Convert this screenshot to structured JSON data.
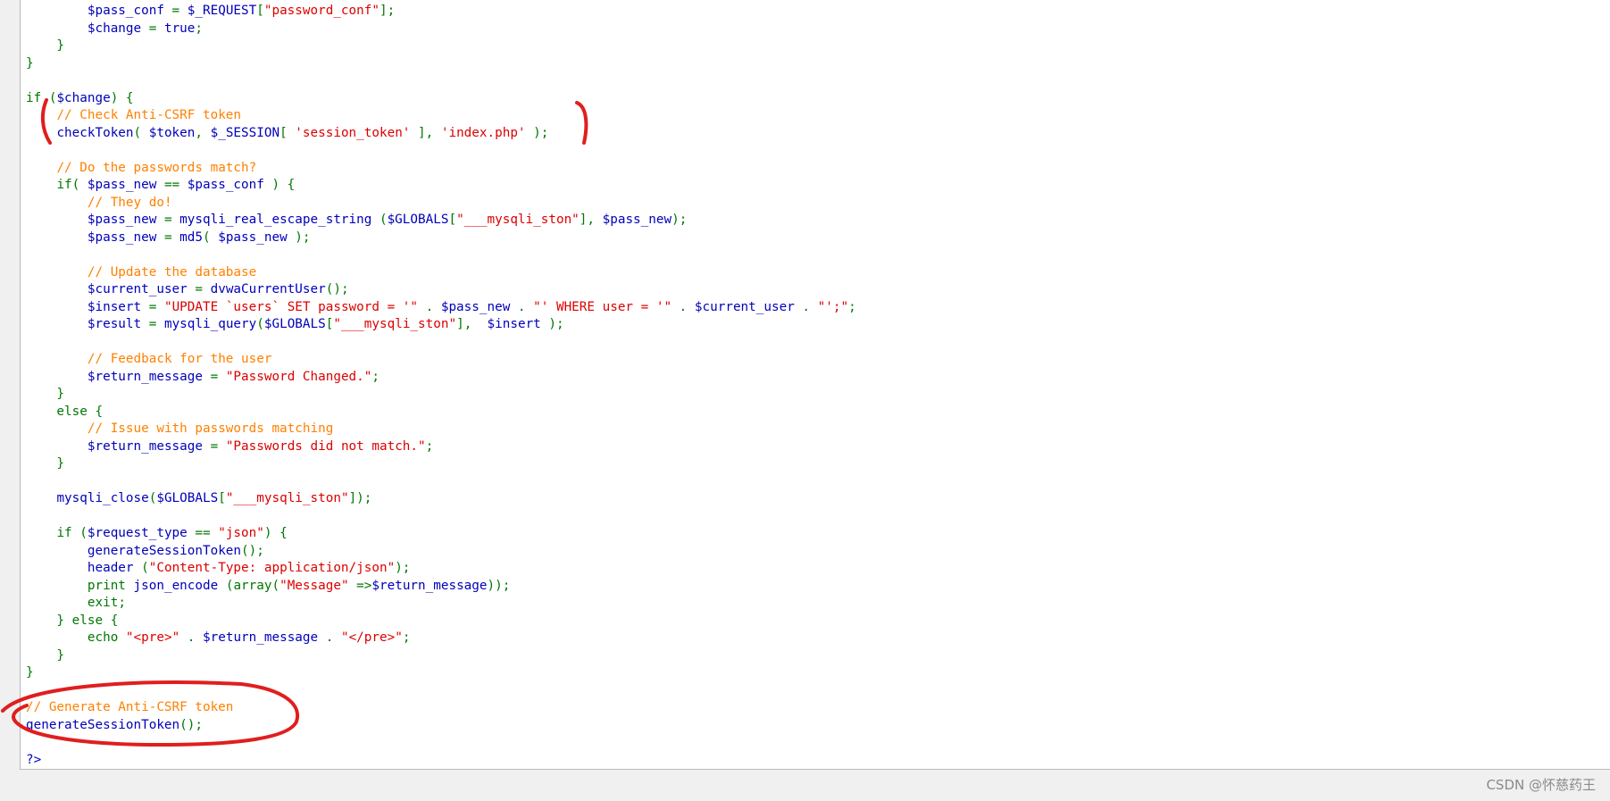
{
  "code": {
    "lines": [
      [
        [
          "        ",
          "op"
        ],
        [
          "$pass_conf",
          "var"
        ],
        [
          " = ",
          "op"
        ],
        [
          "$_REQUEST",
          "var"
        ],
        [
          "[",
          "op"
        ],
        [
          "\"password_conf\"",
          "str"
        ],
        [
          "];",
          "op"
        ]
      ],
      [
        [
          "        ",
          "op"
        ],
        [
          "$change",
          "var"
        ],
        [
          " = ",
          "op"
        ],
        [
          "true",
          "var"
        ],
        [
          ";",
          "op"
        ]
      ],
      [
        [
          "    }",
          "op"
        ]
      ],
      [
        [
          "}",
          "op"
        ]
      ],
      [],
      [
        [
          "if ",
          "kw"
        ],
        [
          "(",
          "op"
        ],
        [
          "$change",
          "var"
        ],
        [
          ") {",
          "op"
        ]
      ],
      [
        [
          "    ",
          "op"
        ],
        [
          "// Check Anti-CSRF token",
          "cm"
        ]
      ],
      [
        [
          "    ",
          "op"
        ],
        [
          "checkToken",
          "var"
        ],
        [
          "( ",
          "op"
        ],
        [
          "$token",
          "var"
        ],
        [
          ", ",
          "op"
        ],
        [
          "$_SESSION",
          "var"
        ],
        [
          "[ ",
          "op"
        ],
        [
          "'session_token'",
          "str"
        ],
        [
          " ], ",
          "op"
        ],
        [
          "'index.php'",
          "str"
        ],
        [
          " );",
          "op"
        ]
      ],
      [],
      [
        [
          "    ",
          "op"
        ],
        [
          "// Do the passwords match?",
          "cm"
        ]
      ],
      [
        [
          "    ",
          "op"
        ],
        [
          "if",
          "kw"
        ],
        [
          "( ",
          "op"
        ],
        [
          "$pass_new",
          "var"
        ],
        [
          " == ",
          "op"
        ],
        [
          "$pass_conf",
          "var"
        ],
        [
          " ) {",
          "op"
        ]
      ],
      [
        [
          "        ",
          "op"
        ],
        [
          "// They do!",
          "cm"
        ]
      ],
      [
        [
          "        ",
          "op"
        ],
        [
          "$pass_new",
          "var"
        ],
        [
          " = ",
          "op"
        ],
        [
          "mysqli_real_escape_string",
          "var"
        ],
        [
          " (",
          "op"
        ],
        [
          "$GLOBALS",
          "var"
        ],
        [
          "[",
          "op"
        ],
        [
          "\"___mysqli_ston\"",
          "str"
        ],
        [
          "], ",
          "op"
        ],
        [
          "$pass_new",
          "var"
        ],
        [
          ");",
          "op"
        ]
      ],
      [
        [
          "        ",
          "op"
        ],
        [
          "$pass_new",
          "var"
        ],
        [
          " = ",
          "op"
        ],
        [
          "md5",
          "var"
        ],
        [
          "( ",
          "op"
        ],
        [
          "$pass_new",
          "var"
        ],
        [
          " );",
          "op"
        ]
      ],
      [],
      [
        [
          "        ",
          "op"
        ],
        [
          "// Update the database",
          "cm"
        ]
      ],
      [
        [
          "        ",
          "op"
        ],
        [
          "$current_user",
          "var"
        ],
        [
          " = ",
          "op"
        ],
        [
          "dvwaCurrentUser",
          "var"
        ],
        [
          "();",
          "op"
        ]
      ],
      [
        [
          "        ",
          "op"
        ],
        [
          "$insert",
          "var"
        ],
        [
          " = ",
          "op"
        ],
        [
          "\"UPDATE `users` SET password = '\"",
          "str"
        ],
        [
          " . ",
          "op"
        ],
        [
          "$pass_new",
          "var"
        ],
        [
          " . ",
          "op"
        ],
        [
          "\"' WHERE user = '\"",
          "str"
        ],
        [
          " . ",
          "op"
        ],
        [
          "$current_user",
          "var"
        ],
        [
          " . ",
          "op"
        ],
        [
          "\"';\"",
          "str"
        ],
        [
          ";",
          "op"
        ]
      ],
      [
        [
          "        ",
          "op"
        ],
        [
          "$result",
          "var"
        ],
        [
          " = ",
          "op"
        ],
        [
          "mysqli_query",
          "var"
        ],
        [
          "(",
          "op"
        ],
        [
          "$GLOBALS",
          "var"
        ],
        [
          "[",
          "op"
        ],
        [
          "\"___mysqli_ston\"",
          "str"
        ],
        [
          "],  ",
          "op"
        ],
        [
          "$insert",
          "var"
        ],
        [
          " );",
          "op"
        ]
      ],
      [],
      [
        [
          "        ",
          "op"
        ],
        [
          "// Feedback for the user",
          "cm"
        ]
      ],
      [
        [
          "        ",
          "op"
        ],
        [
          "$return_message",
          "var"
        ],
        [
          " = ",
          "op"
        ],
        [
          "\"Password Changed.\"",
          "str"
        ],
        [
          ";",
          "op"
        ]
      ],
      [
        [
          "    }",
          "op"
        ]
      ],
      [
        [
          "    else {",
          "op"
        ]
      ],
      [
        [
          "        ",
          "op"
        ],
        [
          "// Issue with passwords matching",
          "cm"
        ]
      ],
      [
        [
          "        ",
          "op"
        ],
        [
          "$return_message",
          "var"
        ],
        [
          " = ",
          "op"
        ],
        [
          "\"Passwords did not match.\"",
          "str"
        ],
        [
          ";",
          "op"
        ]
      ],
      [
        [
          "    }",
          "op"
        ]
      ],
      [],
      [
        [
          "    ",
          "op"
        ],
        [
          "mysqli_close",
          "var"
        ],
        [
          "(",
          "op"
        ],
        [
          "$GLOBALS",
          "var"
        ],
        [
          "[",
          "op"
        ],
        [
          "\"___mysqli_ston\"",
          "str"
        ],
        [
          "]);",
          "op"
        ]
      ],
      [],
      [
        [
          "    ",
          "op"
        ],
        [
          "if ",
          "kw"
        ],
        [
          "(",
          "op"
        ],
        [
          "$request_type",
          "var"
        ],
        [
          " == ",
          "op"
        ],
        [
          "\"json\"",
          "str"
        ],
        [
          ") {",
          "op"
        ]
      ],
      [
        [
          "        ",
          "op"
        ],
        [
          "generateSessionToken",
          "var"
        ],
        [
          "();",
          "op"
        ]
      ],
      [
        [
          "        ",
          "op"
        ],
        [
          "header ",
          "var"
        ],
        [
          "(",
          "op"
        ],
        [
          "\"Content-Type: application/json\"",
          "str"
        ],
        [
          ");",
          "op"
        ]
      ],
      [
        [
          "        ",
          "op"
        ],
        [
          "print ",
          "kw"
        ],
        [
          "json_encode ",
          "var"
        ],
        [
          "(",
          "op"
        ],
        [
          "array",
          "kw"
        ],
        [
          "(",
          "op"
        ],
        [
          "\"Message\"",
          "str"
        ],
        [
          " =>",
          "op"
        ],
        [
          "$return_message",
          "var"
        ],
        [
          "));",
          "op"
        ]
      ],
      [
        [
          "        ",
          "op"
        ],
        [
          "exit",
          "kw"
        ],
        [
          ";",
          "op"
        ]
      ],
      [
        [
          "    } ",
          "op"
        ],
        [
          "else",
          "kw"
        ],
        [
          " {",
          "op"
        ]
      ],
      [
        [
          "        ",
          "op"
        ],
        [
          "echo ",
          "kw"
        ],
        [
          "\"<pre>\"",
          "str"
        ],
        [
          " . ",
          "op"
        ],
        [
          "$return_message",
          "var"
        ],
        [
          " . ",
          "op"
        ],
        [
          "\"</pre>\"",
          "str"
        ],
        [
          ";",
          "op"
        ]
      ],
      [
        [
          "    }",
          "op"
        ]
      ],
      [
        [
          "}",
          "op"
        ]
      ],
      [],
      [
        [
          "// Generate Anti-CSRF token",
          "cm"
        ]
      ],
      [
        [
          "generateSessionToken",
          "var"
        ],
        [
          "();",
          "op"
        ]
      ],
      [],
      [
        [
          "?>",
          "var"
        ]
      ]
    ]
  },
  "watermark": "CSDN @怀慈药王",
  "annotations": {
    "color": "#e01e1e"
  }
}
